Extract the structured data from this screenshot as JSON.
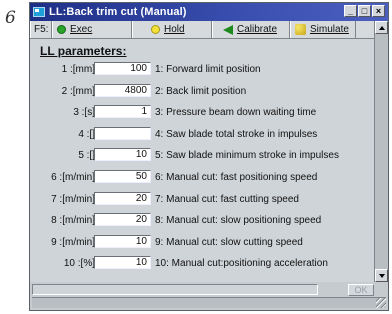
{
  "figure_label": "6",
  "window": {
    "title": "LL:Back trim cut  (Manual)",
    "controls": [
      "_",
      "□",
      "×"
    ]
  },
  "toolbar": {
    "key": "F5:",
    "exec_label": "Exec",
    "hold_label": "Hold",
    "calibrate_label": "Calibrate",
    "simulate_label": "Simulate"
  },
  "section": {
    "title": "LL parameters:"
  },
  "parameters": [
    {
      "label": "1 :[mm]",
      "value": "100",
      "desc": "1: Forward limit position"
    },
    {
      "label": "2 :[mm]",
      "value": "4800",
      "desc": "2: Back limit position"
    },
    {
      "label": "3 :[s]",
      "value": "1",
      "desc": "3: Pressure beam down waiting time"
    },
    {
      "label": "4 :[]",
      "value": "",
      "desc": "4: Saw blade total stroke in impulses"
    },
    {
      "label": "5 :[]",
      "value": "10",
      "desc": "5: Saw blade minimum stroke in impulses"
    },
    {
      "label": "6 :[m/min]",
      "value": "50",
      "desc": "6: Manual cut: fast positioning speed"
    },
    {
      "label": "7 :[m/min]",
      "value": "20",
      "desc": "7: Manual cut: fast cutting speed"
    },
    {
      "label": "8 :[m/min]",
      "value": "20",
      "desc": "8: Manual cut: slow positioning speed"
    },
    {
      "label": "9 :[m/min]",
      "value": "10",
      "desc": "9: Manual cut: slow cutting speed"
    },
    {
      "label": "10 :[%]",
      "value": "10",
      "desc": "10: Manual cut:positioning acceleration"
    }
  ],
  "footer": {
    "ok_label": "OK"
  },
  "colors": {
    "titlebar": "#1e2f86",
    "exec": "#2aa52a",
    "hold": "#f3e13a",
    "calibrate": "#1c8a1c"
  }
}
